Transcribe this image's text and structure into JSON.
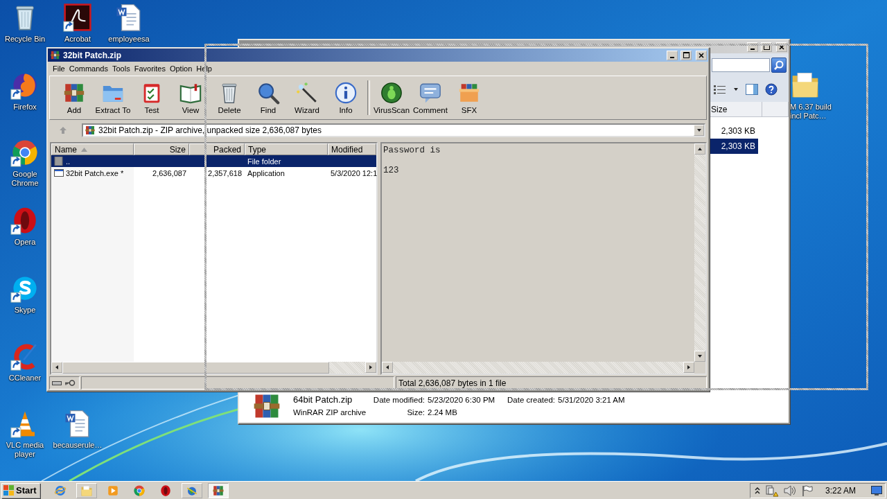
{
  "desktop_icons": [
    {
      "label": "Recycle Bin",
      "kind": "trash",
      "shortcut": false
    },
    {
      "label": "Acrobat",
      "kind": "pdf",
      "shortcut": true
    },
    {
      "label": "employeesa",
      "kind": "document",
      "shortcut": false
    },
    {
      "label": "Firefox",
      "kind": "firefox",
      "shortcut": true
    },
    {
      "label": "Google Chrome",
      "kind": "chrome",
      "shortcut": true
    },
    {
      "label": "Opera",
      "kind": "opera",
      "shortcut": true
    },
    {
      "label": "Skype",
      "kind": "skype",
      "shortcut": true
    },
    {
      "label": "CCleaner",
      "kind": "ccleaner",
      "shortcut": true
    },
    {
      "label": "VLC media player",
      "kind": "vlc",
      "shortcut": true
    },
    {
      "label": "becauserule…",
      "kind": "document",
      "shortcut": false
    },
    {
      "label": "M 6.37 build incl Patc…",
      "kind": "folder",
      "shortcut": false
    }
  ],
  "explorer_window": {
    "columns": [
      {
        "label": "Size"
      }
    ],
    "rows": [
      {
        "size": "2,303 KB",
        "selected": false
      },
      {
        "size": "2,303 KB",
        "selected": true
      }
    ],
    "details": {
      "name": "64bit Patch.zip",
      "type": "WinRAR ZIP archive",
      "fields": [
        {
          "label": "Date modified:",
          "value": "5/23/2020 6:30 PM"
        },
        {
          "label": "Size:",
          "value": "2.24 MB"
        },
        {
          "label": "Date created:",
          "value": "5/31/2020 3:21 AM"
        }
      ]
    }
  },
  "winrar_window": {
    "title": "32bit Patch.zip",
    "menu": [
      "File",
      "Commands",
      "Tools",
      "Favorites",
      "Option",
      "Help"
    ],
    "toolbar": [
      {
        "kind": "add",
        "label": "Add"
      },
      {
        "kind": "extract",
        "label": "Extract To"
      },
      {
        "kind": "test",
        "label": "Test"
      },
      {
        "kind": "view",
        "label": "View"
      },
      {
        "kind": "delete",
        "label": "Delete"
      },
      {
        "kind": "find",
        "label": "Find"
      },
      {
        "kind": "wizard",
        "label": "Wizard"
      },
      {
        "kind": "info",
        "label": "Info"
      },
      {
        "kind": "separator"
      },
      {
        "kind": "virusscan",
        "label": "VirusScan"
      },
      {
        "kind": "comment",
        "label": "Comment"
      },
      {
        "kind": "sfx",
        "label": "SFX"
      }
    ],
    "address": "32bit Patch.zip - ZIP archive, unpacked size 2,636,087 bytes",
    "columns": [
      {
        "label": "Name",
        "sorted": true
      },
      {
        "label": "Size",
        "sorted": false
      },
      {
        "label": "Packed",
        "sorted": false
      },
      {
        "label": "Type",
        "sorted": false
      },
      {
        "label": "Modified",
        "sorted": false
      }
    ],
    "rows": [
      {
        "kind": "parent",
        "name": "..",
        "type": "File folder",
        "selected": true
      },
      {
        "kind": "file",
        "name": "32bit Patch.exe *",
        "size": "2,636,087",
        "packed": "2,357,618",
        "type": "Application",
        "modified": "5/3/2020 12:1",
        "selected": false
      }
    ],
    "preview": [
      "Password is",
      "123"
    ],
    "status": "Total 2,636,087 bytes in 1 file"
  },
  "taskbar": {
    "start": "Start",
    "apps": [
      {
        "kind": "ie",
        "open": false,
        "focused": false
      },
      {
        "kind": "explorer",
        "open": true,
        "focused": false
      },
      {
        "kind": "mediaplayer",
        "open": false,
        "focused": false
      },
      {
        "kind": "chrome",
        "open": false,
        "focused": false
      },
      {
        "kind": "opera",
        "open": false,
        "focused": false
      },
      {
        "kind": "globe",
        "open": true,
        "focused": false
      },
      {
        "kind": "winrar",
        "open": true,
        "focused": true
      }
    ],
    "clock": "3:22 AM"
  }
}
